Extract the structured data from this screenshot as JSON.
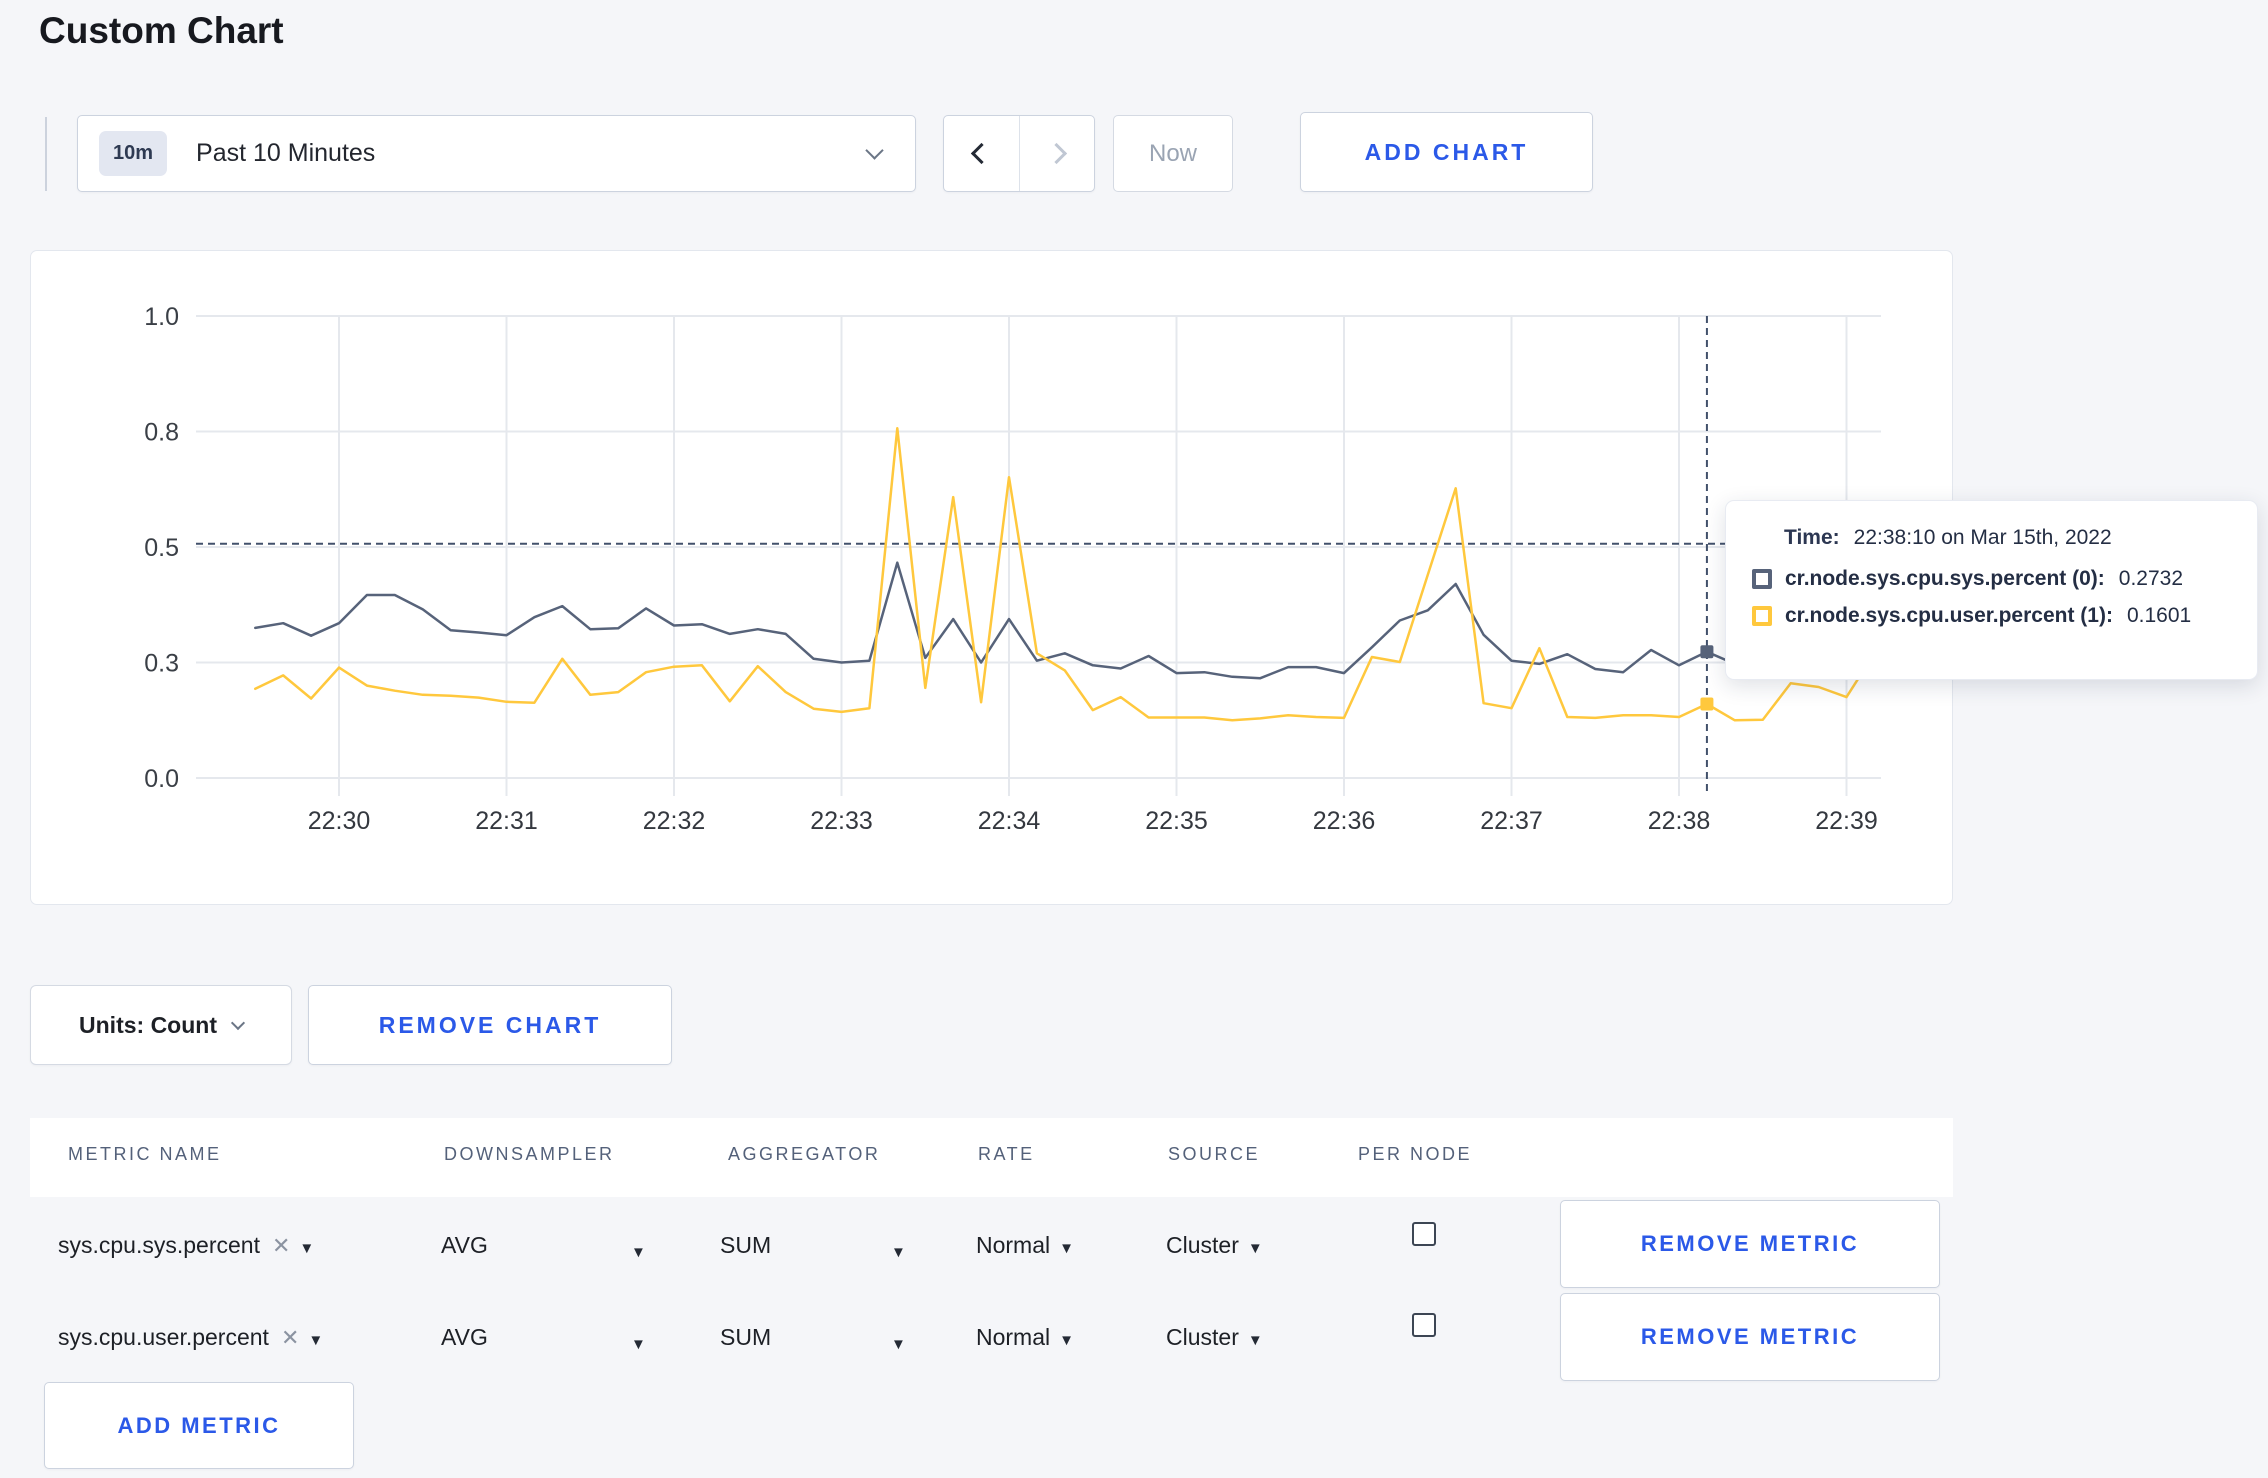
{
  "page": {
    "title": "Custom Chart",
    "background": "#f5f6f9",
    "accent_blue": "#2b59e8"
  },
  "toolbar": {
    "time_badge": "10m",
    "time_label": "Past 10 Minutes",
    "now_label": "Now",
    "add_chart_label": "ADD CHART"
  },
  "chart_panel": {
    "units_label": "Units: Count",
    "remove_chart_label": "REMOVE CHART"
  },
  "chart_data": {
    "type": "line",
    "x_start_min": -0.5,
    "x_step_min": 0.1666667,
    "x_axis": {
      "ticks": [
        {
          "label": "22:30",
          "min": 0
        },
        {
          "label": "22:31",
          "min": 1
        },
        {
          "label": "22:32",
          "min": 2
        },
        {
          "label": "22:33",
          "min": 3
        },
        {
          "label": "22:34",
          "min": 4
        },
        {
          "label": "22:35",
          "min": 5
        },
        {
          "label": "22:36",
          "min": 6
        },
        {
          "label": "22:37",
          "min": 7
        },
        {
          "label": "22:38",
          "min": 8
        },
        {
          "label": "22:39",
          "min": 9
        }
      ]
    },
    "y_axis": {
      "range": [
        0,
        1
      ],
      "ticks": [
        {
          "label": "0.0",
          "value": 0
        },
        {
          "label": "0.3",
          "value": 0.25
        },
        {
          "label": "0.5",
          "value": 0.5
        },
        {
          "label": "0.8",
          "value": 0.75
        },
        {
          "label": "1.0",
          "value": 1.0
        }
      ]
    },
    "grid": true,
    "series": [
      {
        "name": "cr.node.sys.cpu.sys.percent",
        "node": "(0)",
        "color": "#57637a",
        "values": [
          0.325,
          0.335,
          0.308,
          0.335,
          0.396,
          0.396,
          0.365,
          0.32,
          0.315,
          0.309,
          0.348,
          0.372,
          0.322,
          0.324,
          0.367,
          0.33,
          0.333,
          0.312,
          0.322,
          0.312,
          0.258,
          0.25,
          0.254,
          0.466,
          0.26,
          0.344,
          0.25,
          0.344,
          0.254,
          0.27,
          0.244,
          0.237,
          0.264,
          0.227,
          0.229,
          0.219,
          0.216,
          0.24,
          0.24,
          0.227,
          0.283,
          0.341,
          0.363,
          0.42,
          0.31,
          0.254,
          0.247,
          0.268,
          0.236,
          0.229,
          0.277,
          0.244,
          0.2732,
          0.247,
          0.252,
          0.27,
          0.29,
          0.3,
          0.303
        ]
      },
      {
        "name": "cr.node.sys.cpu.user.percent",
        "node": "(1)",
        "color": "#ffc83d",
        "values": [
          0.193,
          0.222,
          0.172,
          0.239,
          0.2,
          0.189,
          0.18,
          0.178,
          0.174,
          0.165,
          0.163,
          0.258,
          0.18,
          0.186,
          0.229,
          0.241,
          0.244,
          0.166,
          0.242,
          0.186,
          0.15,
          0.143,
          0.151,
          0.757,
          0.195,
          0.608,
          0.164,
          0.651,
          0.27,
          0.233,
          0.147,
          0.175,
          0.131,
          0.131,
          0.131,
          0.125,
          0.129,
          0.136,
          0.132,
          0.13,
          0.262,
          0.251,
          0.44,
          0.627,
          0.162,
          0.151,
          0.281,
          0.132,
          0.13,
          0.136,
          0.136,
          0.132,
          0.1601,
          0.125,
          0.126,
          0.205,
          0.197,
          0.175,
          0.27
        ]
      }
    ],
    "crosshair": {
      "time_min": 8.1667,
      "y_value": 0.507,
      "color": "#42516b"
    },
    "tooltip": {
      "time_label": "Time:",
      "time_value": "22:38:10 on Mar 15th, 2022",
      "rows": [
        {
          "label": "cr.node.sys.cpu.sys.percent (0):",
          "value": "0.2732",
          "color": "#242c47"
        },
        {
          "label": "cr.node.sys.cpu.user.percent (1):",
          "value": "0.1601",
          "color": "#ffc020"
        }
      ]
    }
  },
  "metrics_table": {
    "headers": [
      "METRIC NAME",
      "DOWNSAMPLER",
      "AGGREGATOR",
      "RATE",
      "SOURCE",
      "PER NODE"
    ],
    "rows": [
      {
        "metric": "sys.cpu.sys.percent",
        "downsampler": "AVG",
        "aggregator": "SUM",
        "rate": "Normal",
        "source": "Cluster",
        "per_node_checked": false,
        "remove_label": "REMOVE METRIC"
      },
      {
        "metric": "sys.cpu.user.percent",
        "downsampler": "AVG",
        "aggregator": "SUM",
        "rate": "Normal",
        "source": "Cluster",
        "per_node_checked": false,
        "remove_label": "REMOVE METRIC"
      }
    ],
    "add_metric_label": "ADD METRIC"
  }
}
